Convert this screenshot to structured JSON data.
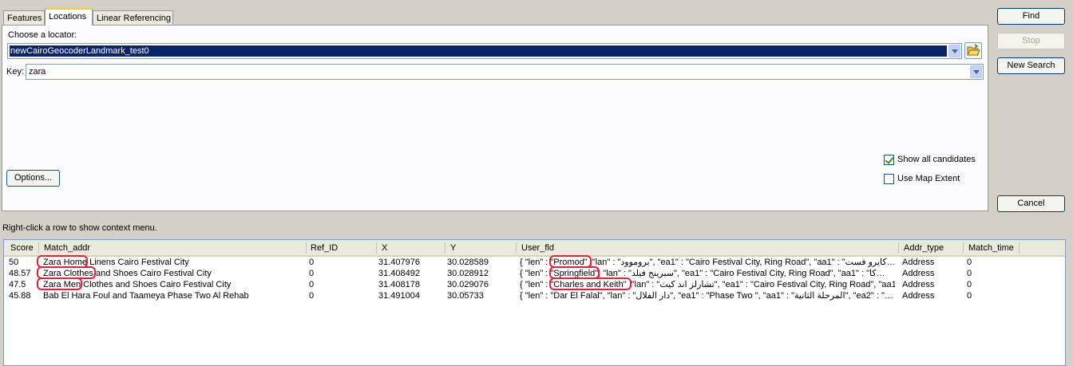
{
  "tabs": {
    "features": "Features",
    "locations": "Locations",
    "linear": "Linear Referencing"
  },
  "locator": {
    "label": "Choose a locator:",
    "value": "newCairoGeocoderLandmark_test0",
    "key_label": "Key:",
    "key_value": "zara"
  },
  "options_label": "Options...",
  "show_all_label": "Show all candidates",
  "use_extent_label": "Use Map Extent",
  "buttons": {
    "find": "Find",
    "stop": "Stop",
    "new_search": "New Search",
    "cancel": "Cancel"
  },
  "hint": "Right-click a row to show context menu.",
  "columns": [
    "Score",
    "Match_addr",
    "Ref_ID",
    "X",
    "Y",
    "User_fld",
    "Addr_type",
    "Match_time"
  ],
  "rows": [
    [
      "50",
      "Zara Home Linens Cairo Festival City",
      "0",
      "31.407976",
      "30.028589",
      "{ \"len\" : \"Promod\" ,\"lan\" : \"بروموود\", \"ea1\" : \"Cairo Festival City, Ring Road\", \"aa1\" : \"كايرو فست…",
      "Address",
      "0"
    ],
    [
      "48.57",
      "Zara Clothes and Shoes Cairo Festival City",
      "0",
      "31.408492",
      "30.028912",
      "{ \"len\" : \"Springfield\", \"lan\" : \"سبرينج فيلد\", \"ea1\" : \"Cairo Festival City, Ring Road\", \"aa1\" : \"كا…",
      "Address",
      "0"
    ],
    [
      "47.5",
      "Zara Men Clothes and Shoes Cairo Festival City",
      "0",
      "31.408178",
      "30.029076",
      "{ \"len\" : \"Charles and Keith\" ,\"lan\" : \"تشارلز اند كيث\", \"ea1\" : \"Cairo Festival City, Ring Road\", \"aa1\" : \"…",
      "Address",
      "0"
    ],
    [
      "45.88",
      "Bab El Hara Foul and Taameya Phase Two  Al Rehab",
      "0",
      "31.491004",
      "30.05733",
      "{ \"len\" : \"Dar El Falal\", \"lan\" : \"دار الفلال\", \"ea1\" : \"Phase Two \", \"aa1\" : \"المرحلة الثانية\", \"ea2\" : \"…",
      "Address",
      "0"
    ]
  ],
  "colors": {
    "selection": "#0a246a",
    "highlight": "#e8203a",
    "tab_accent": "#ffc83c"
  }
}
